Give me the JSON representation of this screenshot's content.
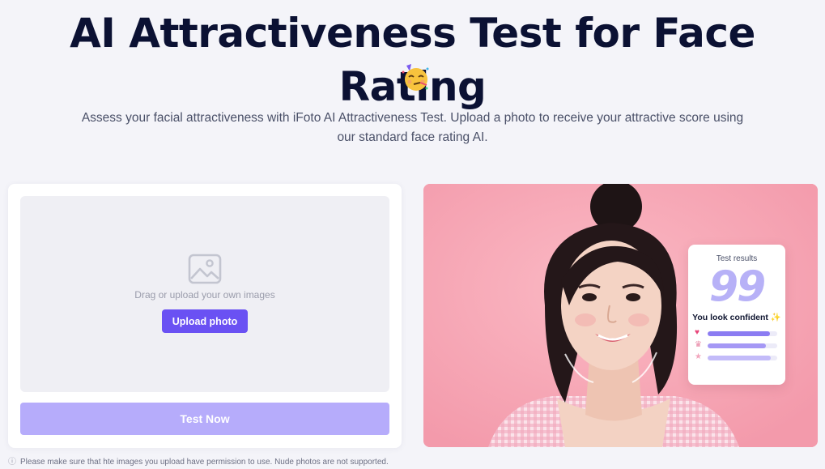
{
  "hero": {
    "title": "AI Attractiveness Test for Face Rating",
    "emoji_icon": "party-face-icon",
    "subtitle": "Assess your facial attractiveness with iFoto AI Attractiveness Test. Upload a photo to receive your attractive score using our standard face rating AI."
  },
  "uploader": {
    "icon": "image-icon",
    "drop_text": "Drag or upload your own images",
    "upload_label": "Upload photo",
    "test_label": "Test Now",
    "notice_icon": "info-icon",
    "notice": "Please make sure that hte images you upload have permission to use. Nude photos are not supported."
  },
  "results_card": {
    "title": "Test results",
    "score": "99",
    "verdict": "You look confident",
    "verdict_icon": "sparkle-icon",
    "metrics": [
      {
        "icon": "heart-icon",
        "glyph": "♥",
        "level": 0.89,
        "icon_color": "#e8467a",
        "bar_color": "#8b7cf2"
      },
      {
        "icon": "crown-icon",
        "glyph": "♛",
        "level": 0.84,
        "icon_color": "#e889a7",
        "bar_color": "#a598f5"
      },
      {
        "icon": "star-icon",
        "glyph": "★",
        "level": 0.91,
        "icon_color": "#f2a6bd",
        "bar_color": "#c3bbf9"
      }
    ]
  },
  "colors": {
    "accent": "#6a51f3",
    "accent_light": "#b6acfb",
    "background": "#f4f4f9",
    "preview_bg": "#f6a5b4"
  }
}
